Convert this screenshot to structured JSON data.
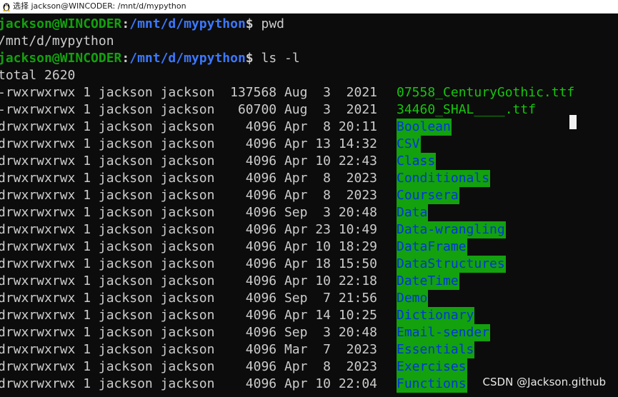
{
  "window": {
    "title": "选择 jackson@WINCODER: /mnt/d/mypython",
    "icon": "linux-penguin-icon"
  },
  "prompt": {
    "user_host": "jackson@WINCODER",
    "colon": ":",
    "path": "/mnt/d/mypython",
    "dollar": "$"
  },
  "commands": {
    "first": " pwd",
    "second": " ls -l"
  },
  "pwd_output": "/mnt/d/mypython",
  "total_line": "total 2620",
  "listing": [
    {
      "meta": "-rwxrwxrwx 1 jackson jackson  137568 Aug  3  2021",
      "name": "07558_CenturyGothic.ttf",
      "kind": "file"
    },
    {
      "meta": "-rwxrwxrwx 1 jackson jackson   60700 Aug  3  2021",
      "name": "34460_SHAL____.ttf",
      "kind": "file"
    },
    {
      "meta": "drwxrwxrwx 1 jackson jackson    4096 Apr  8 20:11",
      "name": "Boolean",
      "kind": "dir"
    },
    {
      "meta": "drwxrwxrwx 1 jackson jackson    4096 Apr 13 14:32",
      "name": "CSV",
      "kind": "dir"
    },
    {
      "meta": "drwxrwxrwx 1 jackson jackson    4096 Apr 10 22:43",
      "name": "Class",
      "kind": "dir"
    },
    {
      "meta": "drwxrwxrwx 1 jackson jackson    4096 Apr  8  2023",
      "name": "Conditionals",
      "kind": "dir"
    },
    {
      "meta": "drwxrwxrwx 1 jackson jackson    4096 Apr  8  2023",
      "name": "Coursera",
      "kind": "dir"
    },
    {
      "meta": "drwxrwxrwx 1 jackson jackson    4096 Sep  3 20:48",
      "name": "Data",
      "kind": "dir"
    },
    {
      "meta": "drwxrwxrwx 1 jackson jackson    4096 Apr 23 10:49",
      "name": "Data-wrangling",
      "kind": "dir"
    },
    {
      "meta": "drwxrwxrwx 1 jackson jackson    4096 Apr 10 18:29",
      "name": "DataFrame",
      "kind": "dir"
    },
    {
      "meta": "drwxrwxrwx 1 jackson jackson    4096 Apr 18 15:50",
      "name": "DataStructures",
      "kind": "dir"
    },
    {
      "meta": "drwxrwxrwx 1 jackson jackson    4096 Apr 10 22:18",
      "name": "DateTime",
      "kind": "dir"
    },
    {
      "meta": "drwxrwxrwx 1 jackson jackson    4096 Sep  7 21:56",
      "name": "Demo",
      "kind": "dir"
    },
    {
      "meta": "drwxrwxrwx 1 jackson jackson    4096 Apr 14 10:25",
      "name": "Dictionary",
      "kind": "dir"
    },
    {
      "meta": "drwxrwxrwx 1 jackson jackson    4096 Sep  3 20:48",
      "name": "Email-sender",
      "kind": "dir"
    },
    {
      "meta": "drwxrwxrwx 1 jackson jackson    4096 Mar  7  2023",
      "name": "Essentials",
      "kind": "dir"
    },
    {
      "meta": "drwxrwxrwx 1 jackson jackson    4096 Apr  8  2023",
      "name": "Exercises",
      "kind": "dir"
    },
    {
      "meta": "drwxrwxrwx 1 jackson jackson    4096 Apr 10 22:04",
      "name": "Functions",
      "kind": "dir"
    }
  ],
  "watermark": "CSDN @Jackson.github",
  "colors": {
    "background": "#0c0c0c",
    "prompt_user": "#13a10e",
    "prompt_path": "#3b78ff",
    "dir_highlight": "#13a10e",
    "dir_text": "#0037da",
    "file_text": "#16c60c",
    "text": "#cccccc"
  }
}
